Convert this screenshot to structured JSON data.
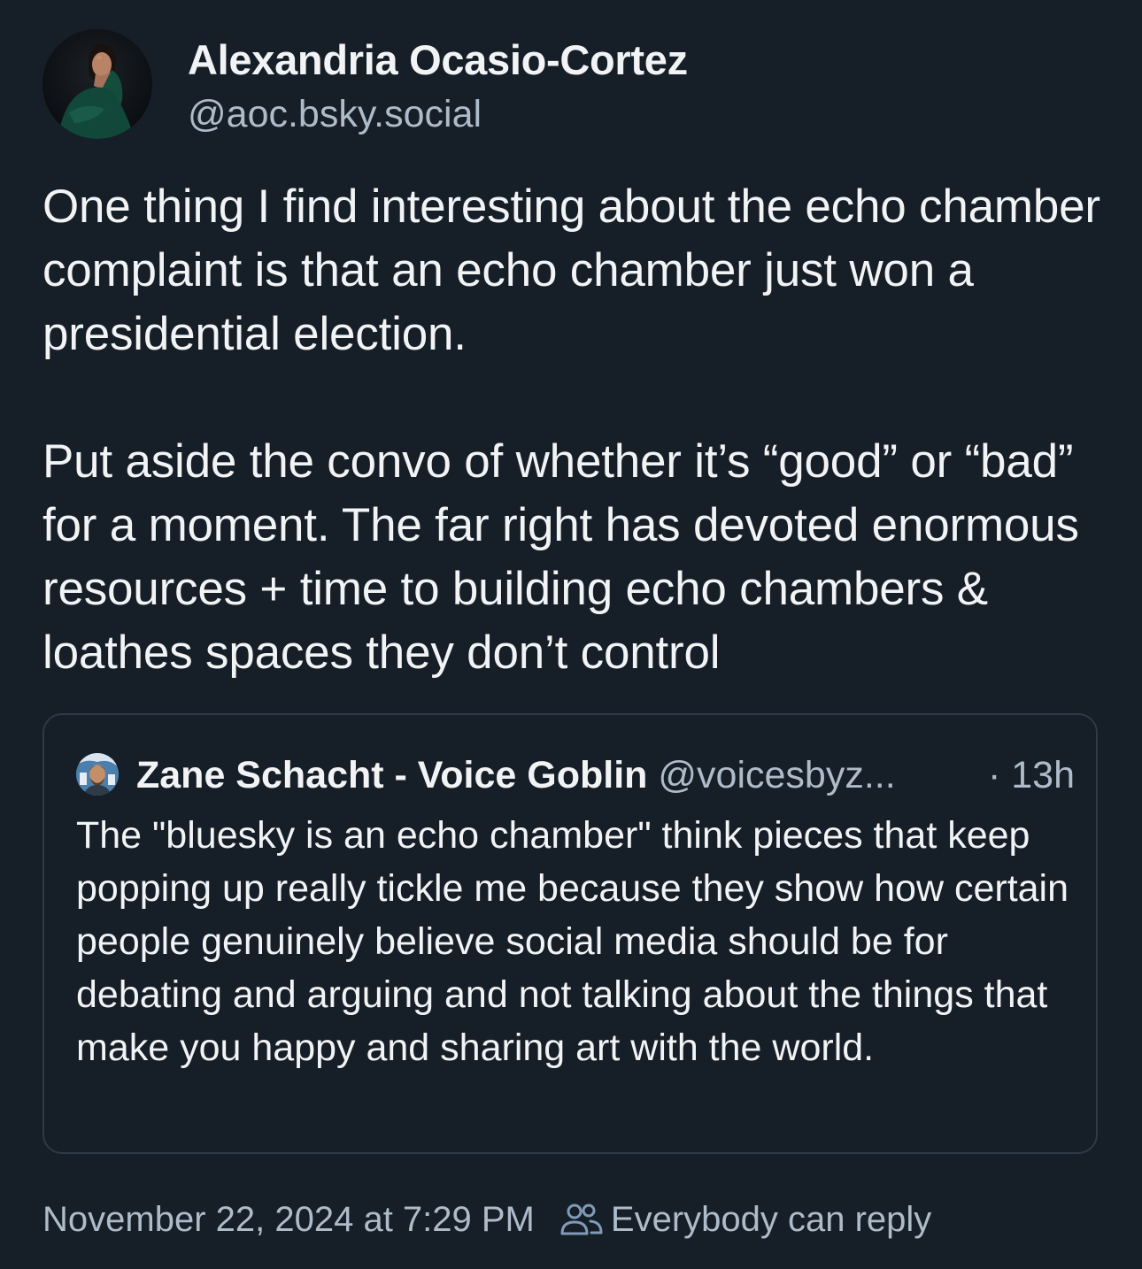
{
  "post": {
    "author": {
      "display_name": "Alexandria Ocasio-Cortez",
      "handle": "@aoc.bsky.social",
      "avatar_icon": "profile-photo"
    },
    "text": "One thing I find interesting about the echo chamber complaint is that an echo chamber just won a presidential election.\n\nPut aside the convo of whether it’s “good” or “bad” for a moment. The far right has devoted enormous resources + time to building echo chambers & loathes spaces they don’t control",
    "quoted_post": {
      "author_name": "Zane Schacht - Voice Goblin",
      "author_handle": "@voicesbyz...",
      "time": "· 13h",
      "avatar_icon": "profile-photo",
      "text": "The \"bluesky is an echo chamber\" think pieces that keep popping up really tickle me because they show how certain people genuinely believe social media should be for debating and arguing and not talking about the things that make you happy and sharing art with the world."
    },
    "timestamp": "November 22, 2024 at 7:29 PM",
    "reply_setting": {
      "icon": "people-icon",
      "label": "Everybody can reply"
    }
  },
  "colors": {
    "background": "#161e27",
    "text_primary": "#f1f3f5",
    "text_secondary": "#aebbc9",
    "quote_border": "#2e3a47"
  }
}
